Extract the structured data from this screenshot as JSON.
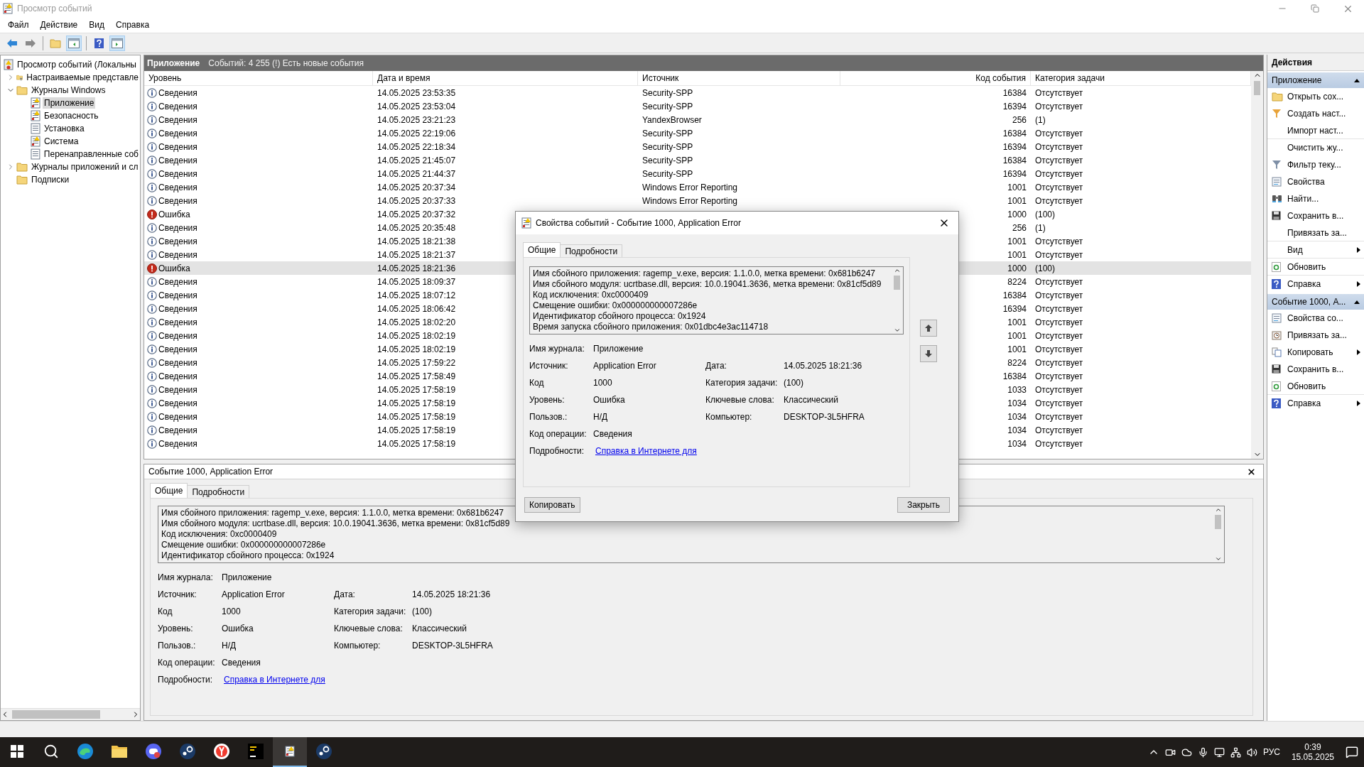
{
  "window": {
    "title": "Просмотр событий"
  },
  "menu": [
    "Файл",
    "Действие",
    "Вид",
    "Справка"
  ],
  "tree": [
    {
      "label": "Просмотр событий (Локальны",
      "kind": "viewer",
      "selected": false,
      "children": [
        {
          "label": "Настраиваемые представле",
          "kind": "folder-filter",
          "expanded": false,
          "selected": false
        },
        {
          "label": "Журналы Windows",
          "kind": "folder",
          "expanded": true,
          "selected": false,
          "children": [
            {
              "label": "Приложение",
              "kind": "log-alert",
              "selected": true
            },
            {
              "label": "Безопасность",
              "kind": "log-alert",
              "selected": false
            },
            {
              "label": "Установка",
              "kind": "log",
              "selected": false
            },
            {
              "label": "Система",
              "kind": "log-alert",
              "selected": false
            },
            {
              "label": "Перенаправленные соб",
              "kind": "log",
              "selected": false
            }
          ]
        },
        {
          "label": "Журналы приложений и сл",
          "kind": "folder",
          "expanded": false,
          "selected": false
        },
        {
          "label": "Подписки",
          "kind": "folder",
          "selected": false
        }
      ]
    }
  ],
  "log_header": {
    "title": "Приложение",
    "summary": "Событий: 4 255 (!) Есть новые события"
  },
  "columns": [
    "Уровень",
    "Дата и время",
    "Источник",
    "Код события",
    "Категория задачи"
  ],
  "rows": [
    {
      "kind": "info",
      "severity": "Сведения",
      "datetime": "14.05.2025 23:53:35",
      "source": "Security-SPP",
      "code": "16384",
      "category": "Отсутствует",
      "selected": false
    },
    {
      "kind": "info",
      "severity": "Сведения",
      "datetime": "14.05.2025 23:53:04",
      "source": "Security-SPP",
      "code": "16394",
      "category": "Отсутствует",
      "selected": false
    },
    {
      "kind": "info",
      "severity": "Сведения",
      "datetime": "14.05.2025 23:21:23",
      "source": "YandexBrowser",
      "code": "256",
      "category": "(1)",
      "selected": false
    },
    {
      "kind": "info",
      "severity": "Сведения",
      "datetime": "14.05.2025 22:19:06",
      "source": "Security-SPP",
      "code": "16384",
      "category": "Отсутствует",
      "selected": false
    },
    {
      "kind": "info",
      "severity": "Сведения",
      "datetime": "14.05.2025 22:18:34",
      "source": "Security-SPP",
      "code": "16394",
      "category": "Отсутствует",
      "selected": false
    },
    {
      "kind": "info",
      "severity": "Сведения",
      "datetime": "14.05.2025 21:45:07",
      "source": "Security-SPP",
      "code": "16384",
      "category": "Отсутствует",
      "selected": false
    },
    {
      "kind": "info",
      "severity": "Сведения",
      "datetime": "14.05.2025 21:44:37",
      "source": "Security-SPP",
      "code": "16394",
      "category": "Отсутствует",
      "selected": false
    },
    {
      "kind": "info",
      "severity": "Сведения",
      "datetime": "14.05.2025 20:37:34",
      "source": "Windows Error Reporting",
      "code": "1001",
      "category": "Отсутствует",
      "selected": false
    },
    {
      "kind": "info",
      "severity": "Сведения",
      "datetime": "14.05.2025 20:37:33",
      "source": "Windows Error Reporting",
      "code": "1001",
      "category": "Отсутствует",
      "selected": false
    },
    {
      "kind": "error",
      "severity": "Ошибка",
      "datetime": "14.05.2025 20:37:32",
      "code": "1000",
      "category": "(100)",
      "selected": false
    },
    {
      "kind": "info",
      "severity": "Сведения",
      "datetime": "14.05.2025 20:35:48",
      "code": "256",
      "category": "(1)",
      "selected": false
    },
    {
      "kind": "info",
      "severity": "Сведения",
      "datetime": "14.05.2025 18:21:38",
      "code": "1001",
      "category": "Отсутствует",
      "selected": false
    },
    {
      "kind": "info",
      "severity": "Сведения",
      "datetime": "14.05.2025 18:21:37",
      "code": "1001",
      "category": "Отсутствует",
      "selected": false
    },
    {
      "kind": "error",
      "severity": "Ошибка",
      "datetime": "14.05.2025 18:21:36",
      "code": "1000",
      "category": "(100)",
      "selected": true
    },
    {
      "kind": "info",
      "severity": "Сведения",
      "datetime": "14.05.2025 18:09:37",
      "code": "8224",
      "category": "Отсутствует",
      "selected": false
    },
    {
      "kind": "info",
      "severity": "Сведения",
      "datetime": "14.05.2025 18:07:12",
      "code": "16384",
      "category": "Отсутствует",
      "selected": false
    },
    {
      "kind": "info",
      "severity": "Сведения",
      "datetime": "14.05.2025 18:06:42",
      "code": "16394",
      "category": "Отсутствует",
      "selected": false
    },
    {
      "kind": "info",
      "severity": "Сведения",
      "datetime": "14.05.2025 18:02:20",
      "code": "1001",
      "category": "Отсутствует",
      "selected": false
    },
    {
      "kind": "info",
      "severity": "Сведения",
      "datetime": "14.05.2025 18:02:19",
      "code": "1001",
      "category": "Отсутствует",
      "selected": false
    },
    {
      "kind": "info",
      "severity": "Сведения",
      "datetime": "14.05.2025 18:02:19",
      "code": "1001",
      "category": "Отсутствует",
      "selected": false
    },
    {
      "kind": "info",
      "severity": "Сведения",
      "datetime": "14.05.2025 17:59:22",
      "code": "8224",
      "category": "Отсутствует",
      "selected": false
    },
    {
      "kind": "info",
      "severity": "Сведения",
      "datetime": "14.05.2025 17:58:49",
      "code": "16384",
      "category": "Отсутствует",
      "selected": false
    },
    {
      "kind": "info",
      "severity": "Сведения",
      "datetime": "14.05.2025 17:58:19",
      "code": "1033",
      "category": "Отсутствует",
      "selected": false
    },
    {
      "kind": "info",
      "severity": "Сведения",
      "datetime": "14.05.2025 17:58:19",
      "code": "1034",
      "category": "Отсутствует",
      "selected": false
    },
    {
      "kind": "info",
      "severity": "Сведения",
      "datetime": "14.05.2025 17:58:19",
      "code": "1034",
      "category": "Отсутствует",
      "selected": false
    },
    {
      "kind": "info",
      "severity": "Сведения",
      "datetime": "14.05.2025 17:58:19",
      "code": "1034",
      "category": "Отсутствует",
      "selected": false
    },
    {
      "kind": "info",
      "severity": "Сведения",
      "datetime": "14.05.2025 17:58:19",
      "code": "1034",
      "category": "Отсутствует",
      "selected": false
    }
  ],
  "detail_panel": {
    "title": "Событие 1000, Application Error",
    "tabs": [
      {
        "label": "Общие",
        "selected": true
      },
      {
        "label": "Подробности",
        "selected": false
      }
    ],
    "description": [
      "Имя сбойного приложения: ragemp_v.exe, версия: 1.1.0.0, метка времени: 0x681b6247",
      "Имя сбойного модуля: ucrtbase.dll, версия: 10.0.19041.3636, метка времени: 0x81cf5d89",
      "Код исключения: 0xc0000409",
      "Смещение ошибки: 0x000000000007286e",
      "Идентификатор сбойного процесса: 0x1924"
    ],
    "fields": [
      {
        "left": {
          "label": "Имя журнала:",
          "value": "Приложение"
        }
      },
      {
        "left": {
          "label": "Источник:",
          "value": "Application Error"
        },
        "right": {
          "label": "Дата:",
          "value": "14.05.2025 18:21:36"
        }
      },
      {
        "left": {
          "label": "Код",
          "value": "1000"
        },
        "right": {
          "label": "Категория задачи:",
          "value": "(100)"
        }
      },
      {
        "left": {
          "label": "Уровень:",
          "value": "Ошибка"
        },
        "right": {
          "label": "Ключевые слова:",
          "value": "Классический"
        }
      },
      {
        "left": {
          "label": "Пользов.:",
          "value": "Н/Д"
        },
        "right": {
          "label": "Компьютер:",
          "value": "DESKTOP-3L5HFRA"
        }
      },
      {
        "left": {
          "label": "Код операции:",
          "value": "Сведения"
        }
      }
    ],
    "more_info": {
      "label": "Подробности:",
      "link": "Справка в Интернете для"
    }
  },
  "dialog": {
    "title": "Свойства событий - Событие 1000, Application Error",
    "tabs": [
      {
        "label": "Общие",
        "selected": true
      },
      {
        "label": "Подробности",
        "selected": false
      }
    ],
    "description": [
      "Имя сбойного приложения: ragemp_v.exe, версия: 1.1.0.0, метка времени: 0x681b6247",
      "Имя сбойного модуля: ucrtbase.dll, версия: 10.0.19041.3636, метка времени: 0x81cf5d89",
      "Код исключения: 0xc0000409",
      "Смещение ошибки: 0x000000000007286e",
      "Идентификатор сбойного процесса: 0x1924",
      "Время запуска сбойного приложения: 0x01dbc4e3ac114718"
    ],
    "fields": [
      {
        "left": {
          "label": "Имя журнала:",
          "value": "Приложение"
        }
      },
      {
        "left": {
          "label": "Источник:",
          "value": "Application Error"
        },
        "right": {
          "label": "Дата:",
          "value": "14.05.2025 18:21:36"
        }
      },
      {
        "left": {
          "label": "Код",
          "value": "1000"
        },
        "right": {
          "label": "Категория задачи:",
          "value": "(100)"
        }
      },
      {
        "left": {
          "label": "Уровень:",
          "value": "Ошибка"
        },
        "right": {
          "label": "Ключевые слова:",
          "value": "Классический"
        }
      },
      {
        "left": {
          "label": "Пользов.:",
          "value": "Н/Д"
        },
        "right": {
          "label": "Компьютер:",
          "value": "DESKTOP-3L5HFRA"
        }
      },
      {
        "left": {
          "label": "Код операции:",
          "value": "Сведения"
        }
      }
    ],
    "more_info": {
      "label": "Подробности:",
      "link": "Справка в Интернете для"
    },
    "buttons": [
      "Копировать",
      "Закрыть"
    ]
  },
  "actions": {
    "title": "Действия",
    "sections": [
      {
        "title": "Приложение",
        "expanded": true,
        "items": [
          {
            "label": "Открыть сох...",
            "kind": "folder",
            "submenu": false,
            "divider_after": false
          },
          {
            "label": "Создать наст...",
            "kind": "filter-star",
            "submenu": false,
            "divider_after": false
          },
          {
            "label": "Импорт наст...",
            "kind": "none",
            "submenu": false,
            "divider_after": true
          },
          {
            "label": "Очистить жу...",
            "kind": "none",
            "submenu": false,
            "divider_after": false
          },
          {
            "label": "Фильтр теку...",
            "kind": "filter",
            "submenu": false,
            "divider_after": false
          },
          {
            "label": "Свойства",
            "kind": "properties",
            "submenu": false,
            "divider_after": false
          },
          {
            "label": "Найти...",
            "kind": "binoculars",
            "submenu": false,
            "divider_after": false
          },
          {
            "label": "Сохранить в...",
            "kind": "save",
            "submenu": false,
            "divider_after": false
          },
          {
            "label": "Привязать за...",
            "kind": "none",
            "submenu": false,
            "divider_after": true
          },
          {
            "label": "Вид",
            "kind": "none",
            "submenu": true,
            "divider_after": true
          },
          {
            "label": "Обновить",
            "kind": "refresh",
            "submenu": false,
            "divider_after": true
          },
          {
            "label": "Справка",
            "kind": "help",
            "submenu": true,
            "divider_after": false
          }
        ]
      },
      {
        "title": "Событие 1000, А...",
        "expanded": true,
        "items": [
          {
            "label": "Свойства со...",
            "kind": "properties",
            "submenu": false,
            "divider_after": false
          },
          {
            "label": "Привязать за...",
            "kind": "clock",
            "submenu": false,
            "divider_after": false
          },
          {
            "label": "Копировать",
            "kind": "copy",
            "submenu": true,
            "divider_after": false
          },
          {
            "label": "Сохранить в...",
            "kind": "save",
            "submenu": false,
            "divider_after": false
          },
          {
            "label": "Обновить",
            "kind": "refresh",
            "submenu": false,
            "divider_after": true
          },
          {
            "label": "Справка",
            "kind": "help",
            "submenu": true,
            "divider_after": false
          }
        ]
      }
    ]
  },
  "taskbar": {
    "apps": [
      {
        "kind": "edge",
        "selected": false
      },
      {
        "kind": "explorer",
        "selected": false
      },
      {
        "kind": "chat",
        "selected": false
      },
      {
        "kind": "steam",
        "selected": false
      },
      {
        "kind": "browser",
        "selected": false
      },
      {
        "kind": "ide",
        "selected": false
      },
      {
        "kind": "viewer",
        "selected": true
      },
      {
        "kind": "steam",
        "selected": false
      }
    ],
    "language": "РУС",
    "time": "0:39",
    "date": "15.05.2025"
  }
}
